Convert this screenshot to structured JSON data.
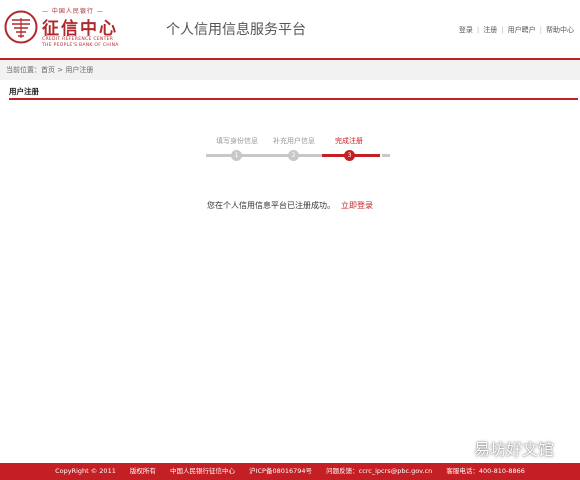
{
  "header": {
    "logo": {
      "top_text": "— 中国人民银行 —",
      "main_text": "征信中心",
      "en_line1": "CREDIT REFERENCE CENTER",
      "en_line2": "THE PEOPLE'S BANK OF CHINA"
    },
    "site_title": "个人信用信息服务平台",
    "links": [
      "登录",
      "注册",
      "用户聘户",
      "帮助中心"
    ]
  },
  "breadcrumb": "当前位置：首页 > 用户注册",
  "section_title": "用户注册",
  "steps": [
    {
      "label": "填写身份信息",
      "number": "1"
    },
    {
      "label": "补充用户信息",
      "number": "2"
    },
    {
      "label": "完成注册",
      "number": "3"
    }
  ],
  "message": {
    "text": "您在个人信用信息平台已注册成功。",
    "link": "立即登录"
  },
  "footer": {
    "items": [
      "CopyRight © 2011",
      "版权所有",
      "中国人民银行征信中心",
      "沪ICP备08016794号",
      "问题反馈：ccrc_ipcrs@pbc.gov.cn",
      "客服电话：400-810-8866"
    ]
  },
  "watermark": "易坊好文馆",
  "colors": {
    "brand_red": "#c41f24",
    "inactive_gray": "#c8c8c8"
  }
}
